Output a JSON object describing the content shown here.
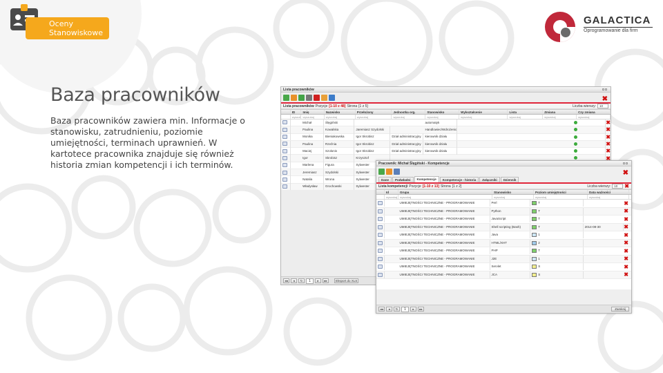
{
  "brand": {
    "badge": "Oceny\nStanowiskowe",
    "company": "GALACTICA",
    "tagline": "Oprogramowanie dla firm"
  },
  "title": "Baza pracowników",
  "description": "Baza pracowników zawiera min. Informacje o stanowisku, zatrudnieniu, poziomie umiejętności, terminach uprawnień. W kartotece pracownika znajduje się również historia zmian kompetencji i ich terminów.",
  "colors": {
    "accent": "#f5a81c",
    "brand_red": "#c0283a",
    "status_ok": "#3cab3c"
  },
  "list_window": {
    "title": "Lista pracowników",
    "list_label": "Lista pracowników",
    "position_label": "Pozycje",
    "position_value": "[1-10 z 48]",
    "page_label": "Strona",
    "page_value": "[1 z 5]",
    "per_page_label": "Liczba wierszy:",
    "per_page_value": "10",
    "columns": [
      "ID",
      "Imię",
      "Nazwisko",
      "Przełożony",
      "Jednostka org.",
      "Stanowisko",
      "Wykształcenie",
      "Lista",
      "Zmiana",
      "Czy zmiana"
    ],
    "filter_placeholder": "wyszukaj",
    "rows": [
      {
        "first": "Michał",
        "last": "Ślęgiński",
        "boss": "",
        "unit": "",
        "position": "automatyk"
      },
      {
        "first": "Paulina",
        "last": "Kowalska",
        "boss": "Jaremiasz Szydolski",
        "unit": "",
        "position": "Handlowiec/Wdrożeniowiec wydaje"
      },
      {
        "first": "Monika",
        "last": "Bieniakowska",
        "boss": "Igor Skrobisz",
        "unit": "Dział administracyjny",
        "position": "kierownik działu"
      },
      {
        "first": "Paulina",
        "last": "Rzeźnia",
        "boss": "Igor Skrobisz",
        "unit": "Dział administracyjny",
        "position": "kierownik działu"
      },
      {
        "first": "Maciej",
        "last": "Szołonis",
        "boss": "Igor Skrobisz",
        "unit": "Dział administracyjny",
        "position": "kierownik działu"
      },
      {
        "first": "Igor",
        "last": "Skrobisz",
        "boss": "Krzysztof",
        "unit": "",
        "position": ""
      },
      {
        "first": "Marlena",
        "last": "Figura",
        "boss": "Sylwester",
        "unit": "",
        "position": ""
      },
      {
        "first": "Jeremiasz",
        "last": "Szydolski",
        "boss": "Sylwester",
        "unit": "",
        "position": ""
      },
      {
        "first": "Natalia",
        "last": "Wrona",
        "boss": "Sylwester",
        "unit": "",
        "position": ""
      },
      {
        "first": "Władysław",
        "last": "Grochowski",
        "boss": "Sylwester",
        "unit": "",
        "position": ""
      }
    ],
    "pager_page": "1",
    "export_label": "Eksport do XLS"
  },
  "detail_window": {
    "title": "Pracownik: Michał Ślęgiński - Kompetencje",
    "tabs": [
      "Dane",
      "Podwładni",
      "Kompetencje",
      "Kompetencje - historia",
      "Załączniki",
      "Dziennik"
    ],
    "active_tab": 2,
    "list_label": "Lista kompetencji",
    "position_label": "Pozycje",
    "position_value": "[1-10 z 13]",
    "page_label": "Strona",
    "page_value": "[1 z 2]",
    "per_page_label": "Liczba wierszy:",
    "per_page_value": "10",
    "columns": [
      "Id",
      "Grupa",
      "Stanowisko",
      "Poziom umiejętności",
      "Data ważności"
    ],
    "filter_placeholder": "wyszukaj",
    "rows": [
      {
        "group": "UMIEJĘTNOŚCI TECHNICZNE - PROGRAMOWANIE",
        "skill": "Perl",
        "level": "T",
        "level_color": "#7fcf6b",
        "date": ""
      },
      {
        "group": "UMIEJĘTNOŚCI TECHNICZNE - PROGRAMOWANIE",
        "skill": "Python",
        "level": "T",
        "level_color": "#7fcf6b",
        "date": ""
      },
      {
        "group": "UMIEJĘTNOŚCI TECHNICZNE - PROGRAMOWANIE",
        "skill": "JavaScript",
        "level": "T",
        "level_color": "#7fcf6b",
        "date": ""
      },
      {
        "group": "UMIEJĘTNOŚCI TECHNICZNE - PROGRAMOWANIE",
        "skill": "Shell scripting (Bash)",
        "level": "T",
        "level_color": "#7fcf6b",
        "date": "2014-08-30"
      },
      {
        "group": "UMIEJĘTNOŚCI TECHNICZNE - PROGRAMOWANIE",
        "skill": "Java",
        "level": "1",
        "level_color": "#cde6f5",
        "date": ""
      },
      {
        "group": "UMIEJĘTNOŚCI TECHNICZNE - PROGRAMOWANIE",
        "skill": "HTML/XHT",
        "level": "2",
        "level_color": "#9ec9e8",
        "date": ""
      },
      {
        "group": "UMIEJĘTNOŚCI TECHNICZNE - PROGRAMOWANIE",
        "skill": "PHP",
        "level": "T",
        "level_color": "#7fcf6b",
        "date": ""
      },
      {
        "group": "UMIEJĘTNOŚCI TECHNICZNE - PROGRAMOWANIE",
        "skill": "J2E",
        "level": "1",
        "level_color": "#cde6f5",
        "date": ""
      },
      {
        "group": "UMIEJĘTNOŚCI TECHNICZNE - PROGRAMOWANIE",
        "skill": "Servlet",
        "level": "S",
        "level_color": "#f2ee8e",
        "date": ""
      },
      {
        "group": "UMIEJĘTNOŚCI TECHNICZNE - PROGRAMOWANIE",
        "skill": "JCA",
        "level": "S",
        "level_color": "#f2ee8e",
        "date": ""
      }
    ],
    "pager_page": "1",
    "close_label": "Zamknij"
  }
}
